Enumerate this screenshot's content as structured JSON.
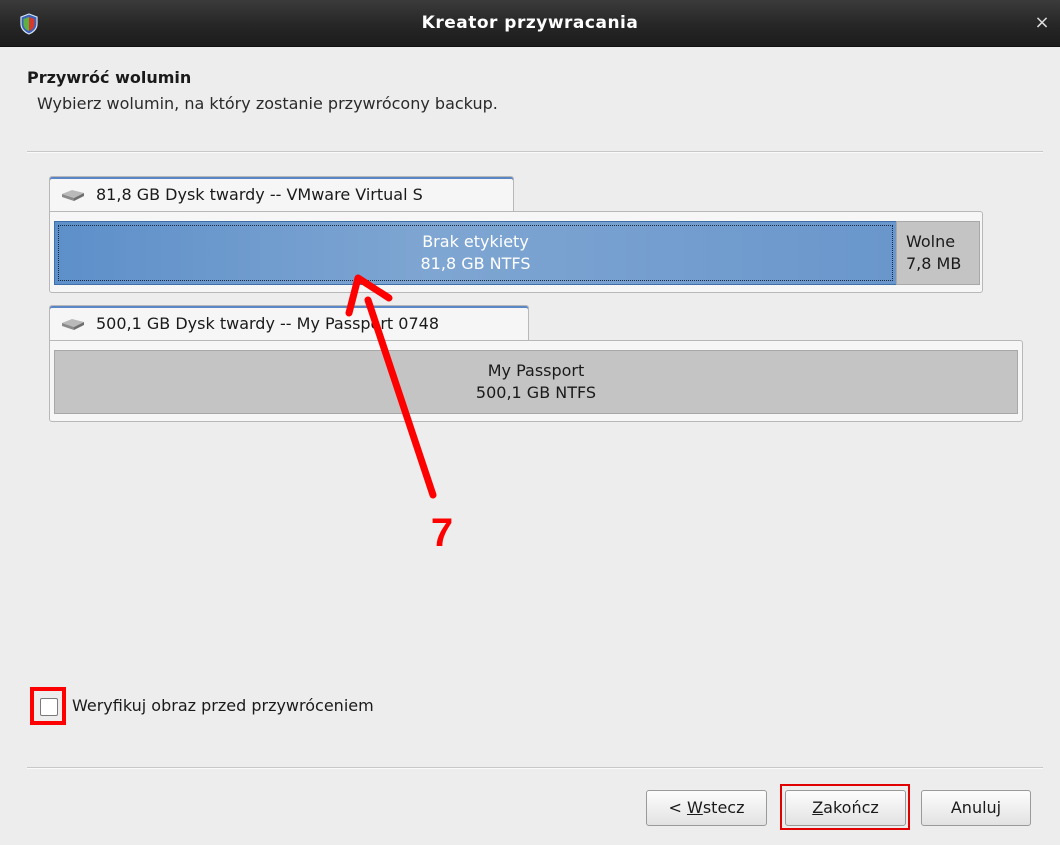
{
  "window": {
    "title": "Kreator przywracania",
    "close_glyph": "×",
    "app_icon": "shield-icon"
  },
  "header": {
    "title": "Przywróć wolumin",
    "subtitle": "Wybierz wolumin, na który zostanie przywrócony backup."
  },
  "disks": [
    {
      "label": "81,8 GB Dysk twardy -- VMware Virtual S",
      "icon": "hard-disk-icon",
      "partitions": [
        {
          "name": "Brak etykiety",
          "detail": "81,8 GB NTFS",
          "selected": true
        },
        {
          "name": "Wolne",
          "detail": "7,8 MB",
          "selected": false
        }
      ]
    },
    {
      "label": "500,1 GB Dysk twardy -- My Passport 0748",
      "icon": "hard-disk-icon",
      "partitions": [
        {
          "name": "My Passport",
          "detail": "500,1 GB NTFS",
          "selected": false
        }
      ]
    }
  ],
  "annotation": {
    "number": "7",
    "color": "#ff0000"
  },
  "verify": {
    "label": "Weryfikuj obraz przed przywróceniem",
    "checked": false
  },
  "buttons": {
    "back_prefix": "< ",
    "back_mnemonic": "W",
    "back_rest": "stecz",
    "finish_mnemonic": "Z",
    "finish_rest": "akończ",
    "cancel": "Anuluj"
  },
  "colors": {
    "selection": "#6996cc",
    "highlight": "#ff0000",
    "titlebar": "#262626"
  }
}
